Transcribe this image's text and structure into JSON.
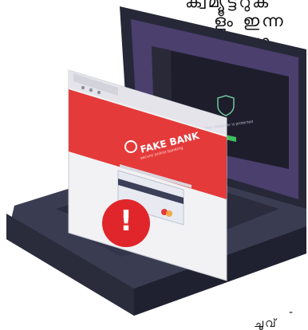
{
  "caption": {
    "line1": "ക്വമ്യൂട്ടറുക",
    "line2": "ളും ഇന്ന",
    "line3": "സാ",
    "line4": "-",
    "line5": "ചൂവ്"
  },
  "illustration": {
    "browser_brand": "FAKE BANK",
    "brand_tagline": "secure online banking",
    "screen_message": "Your computer is protected",
    "warning_symbol": "!"
  },
  "colors": {
    "laptop_body": "#3a3d52",
    "keyboard": "#2b2d3e",
    "screen_bezel": "#262838",
    "screen_bg": "#4b3f6e",
    "browser_red": "#e53a3a",
    "alert_red": "#e0262b",
    "browser_frame": "#f2f2f4"
  },
  "icons": [
    "laptop-icon",
    "browser-window-icon",
    "credit-card-icon",
    "warning-icon",
    "fake-bank-logo-icon"
  ]
}
